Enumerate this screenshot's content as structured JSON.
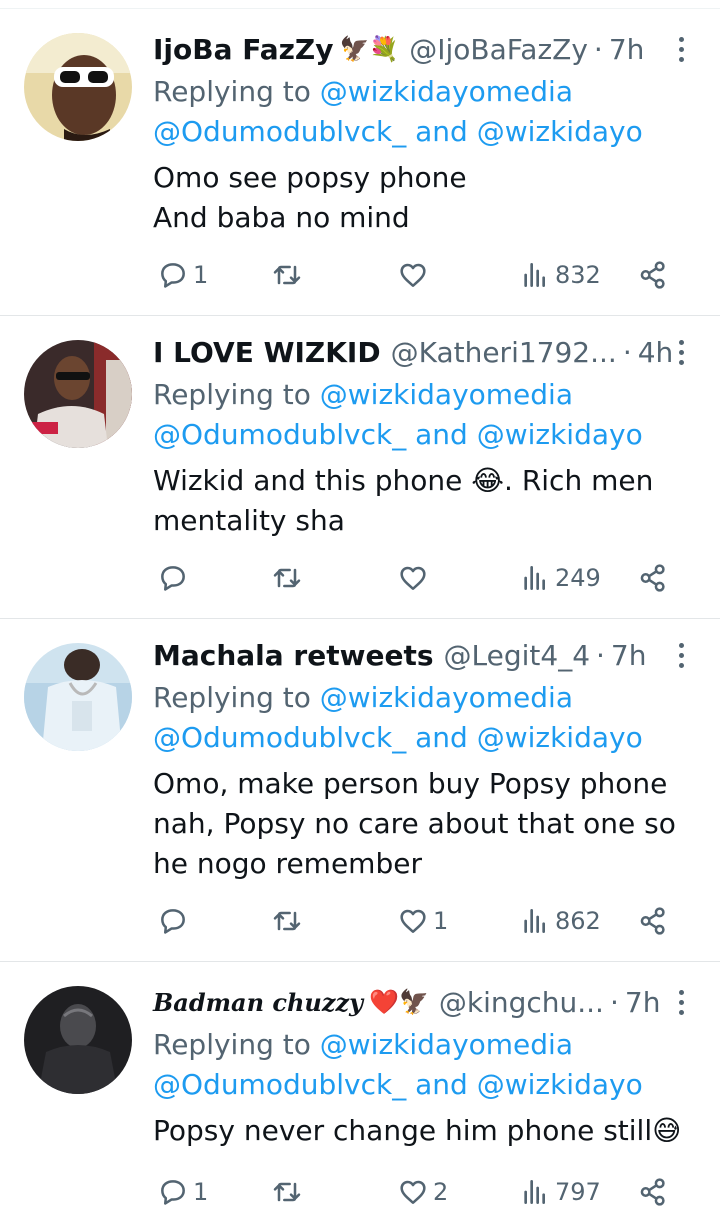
{
  "tweets": [
    {
      "name": "IjoBa FazZy",
      "name_emoji": "🦅💐",
      "handle": "@IjoBaFazZy",
      "separator": "·",
      "time": "7h",
      "replying_prefix": "Replying to",
      "replying_line1": "@wizkidayomedia",
      "replying_line2": "@Odumodublvck_ and @wizkidayo",
      "text": "Omo see popsy phone\nAnd baba no mind",
      "reply_count": "1",
      "retweet_count": "",
      "like_count": "",
      "view_count": "832"
    },
    {
      "name": "I LOVE WIZKID",
      "name_emoji": "",
      "handle": "@Katheri1792...",
      "separator": "·",
      "time": "4h",
      "replying_prefix": "Replying to",
      "replying_line1": "@wizkidayomedia",
      "replying_line2": "@Odumodublvck_ and @wizkidayo",
      "text": "Wizkid and this phone 😂. Rich men\nmentality sha",
      "reply_count": "",
      "retweet_count": "",
      "like_count": "",
      "view_count": "249"
    },
    {
      "name": "Machala retweets",
      "name_emoji": "",
      "handle": "@Legit4_4",
      "separator": "·",
      "time": "7h",
      "replying_prefix": "Replying to",
      "replying_line1": "@wizkidayomedia",
      "replying_line2": "@Odumodublvck_ and @wizkidayo",
      "text": "Omo, make person buy Popsy phone\nnah, Popsy no care about that one so\nhe nogo remember",
      "reply_count": "",
      "retweet_count": "",
      "like_count": "1",
      "view_count": "862"
    },
    {
      "name": "Badman chuzzy",
      "name_emoji": "❤️🦅",
      "handle": "@kingchu...",
      "separator": "·",
      "time": "7h",
      "replying_prefix": "Replying to",
      "replying_line1": "@wizkidayomedia",
      "replying_line2": "@Odumodublvck_ and @wizkidayo",
      "text": "Popsy never change him phone still😅",
      "reply_count": "1",
      "retweet_count": "",
      "like_count": "2",
      "view_count": "797"
    }
  ],
  "icons": {
    "reply": "reply-icon",
    "retweet": "retweet-icon",
    "like": "heart-icon",
    "views": "views-icon",
    "share": "share-icon",
    "more": "more-icon"
  },
  "colors": {
    "link": "#1d9bf0",
    "secondary": "#536471",
    "text": "#0f1419",
    "divider": "#e3e6e8"
  }
}
